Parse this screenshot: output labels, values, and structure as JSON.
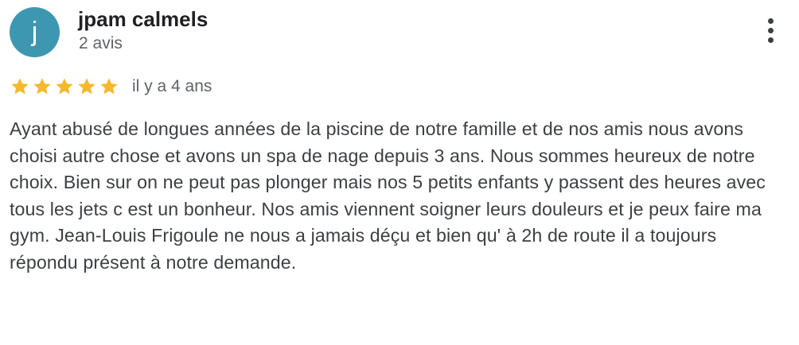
{
  "review": {
    "author": {
      "name": "jpam calmels",
      "initial": "j",
      "review_count": "2 avis",
      "avatar_color": "#3e97b0"
    },
    "rating": {
      "stars": 5,
      "max_stars": 5,
      "star_color": "#f5b92c",
      "empty_star_color": "#dadce0"
    },
    "date": "il y a 4 ans",
    "text": "Ayant abusé de longues années de la piscine de notre famille et de nos amis nous avons choisi autre chose et avons un spa de nage depuis 3 ans. Nous sommes heureux de notre choix. Bien sur on ne peut pas plonger mais nos 5 petits enfants y passent des heures avec tous les jets c est un bonheur. Nos amis viennent soigner leurs douleurs et je peux faire ma gym. Jean-Louis Frigoule ne nous a jamais déçu et bien qu' à 2h de route il a toujours répondu présent à notre demande.",
    "actions": {
      "more_icon": "more-vert-icon"
    }
  }
}
